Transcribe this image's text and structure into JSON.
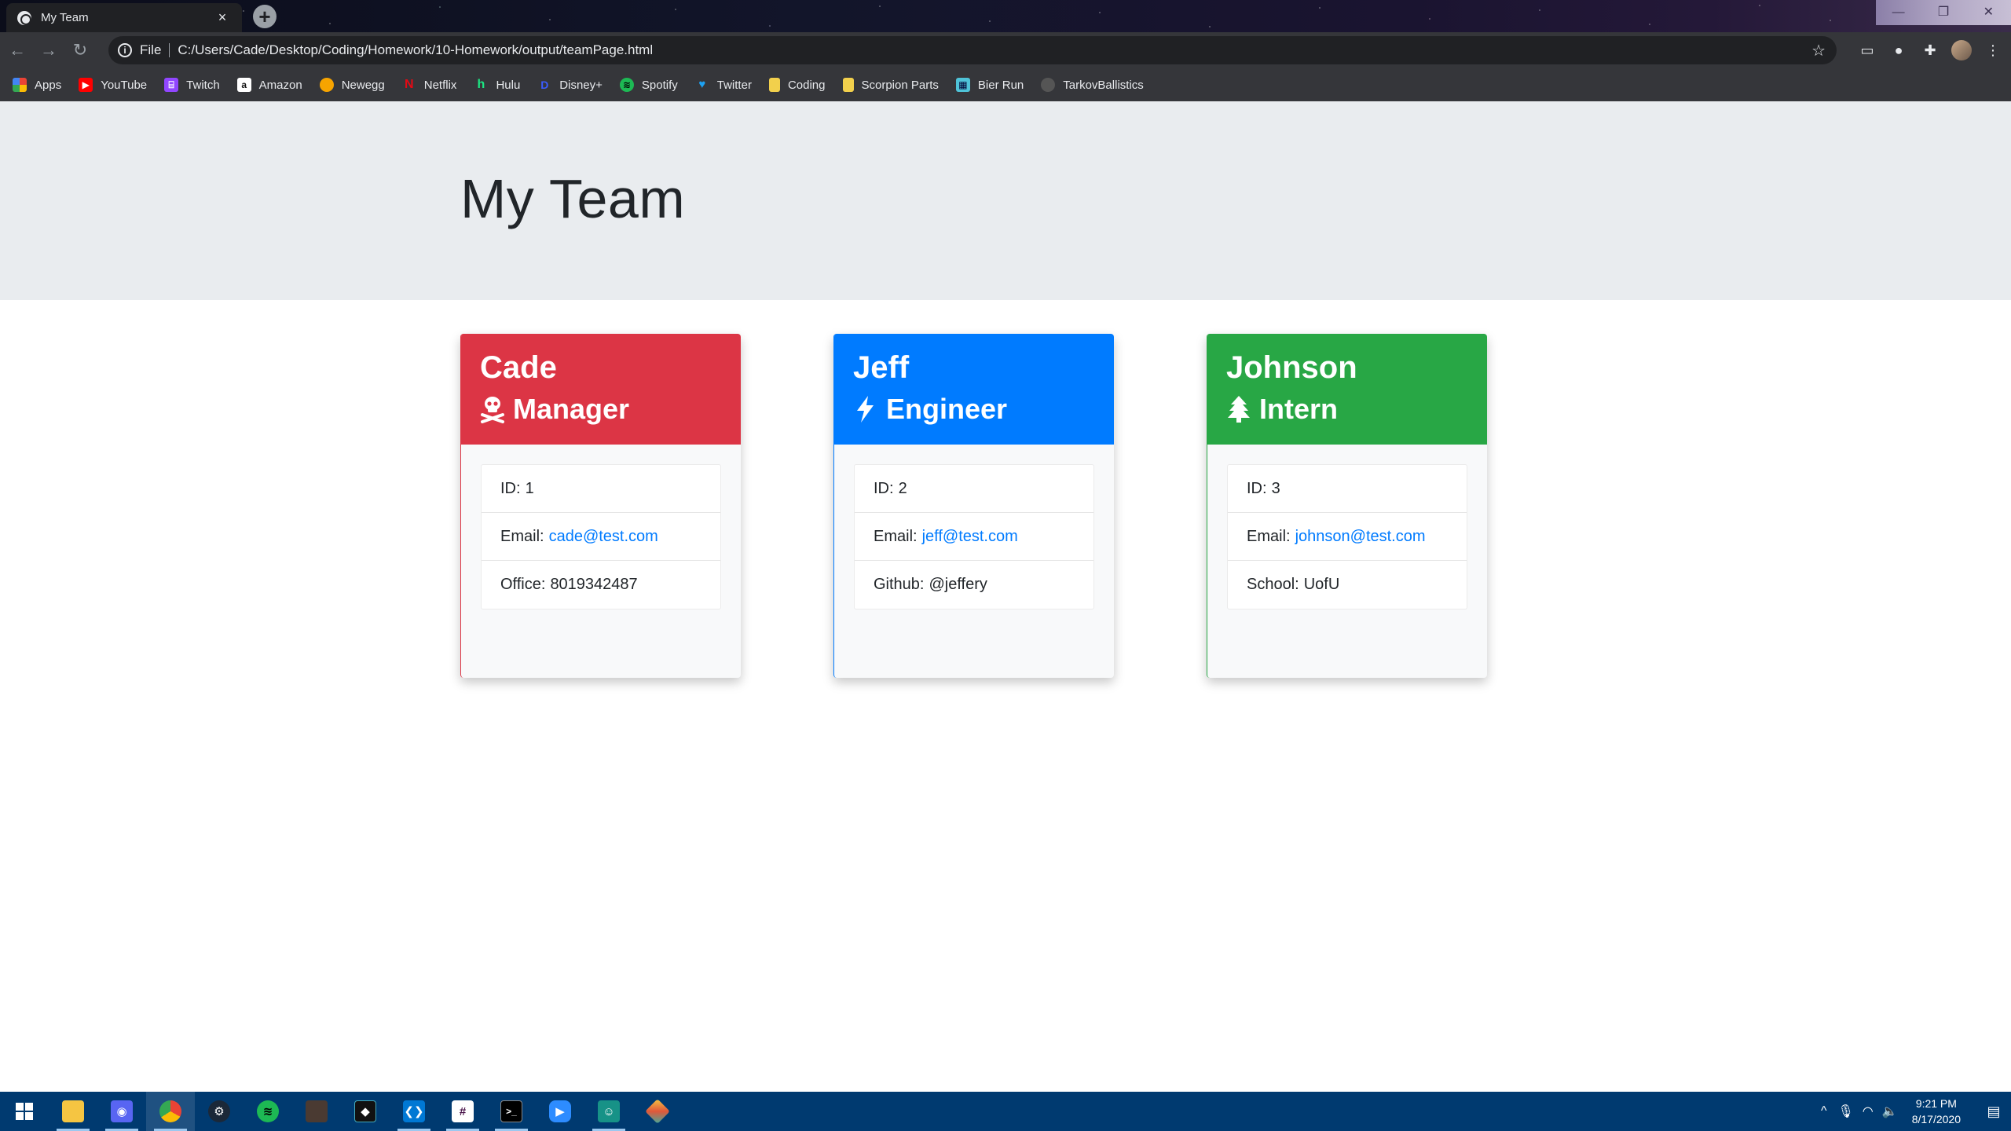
{
  "browser": {
    "tab_title": "My Team",
    "tab_close": "×",
    "new_tab": "+",
    "scheme": "File",
    "url": "C:/Users/Cade/Desktop/Coding/Homework/10-Homework/output/teamPage.html",
    "bookmarks": [
      {
        "label": "Apps",
        "icon": "apps-grid-icon",
        "color": "#ea4335"
      },
      {
        "label": "YouTube",
        "icon": "youtube-icon",
        "color": "#ff0000"
      },
      {
        "label": "Twitch",
        "icon": "twitch-icon",
        "color": "#9146ff"
      },
      {
        "label": "Amazon",
        "icon": "amazon-icon",
        "color": "#ffffff"
      },
      {
        "label": "Newegg",
        "icon": "newegg-icon",
        "color": "#f7a400"
      },
      {
        "label": "Netflix",
        "icon": "netflix-icon",
        "color": "#e50914"
      },
      {
        "label": "Hulu",
        "icon": "hulu-icon",
        "color": "#1ce783"
      },
      {
        "label": "Disney+",
        "icon": "disney-icon",
        "color": "#113ccf"
      },
      {
        "label": "Spotify",
        "icon": "spotify-icon",
        "color": "#1db954"
      },
      {
        "label": "Twitter",
        "icon": "twitter-icon",
        "color": "#1da1f2"
      },
      {
        "label": "Coding",
        "icon": "folder-icon",
        "color": "#f2d04c"
      },
      {
        "label": "Scorpion Parts",
        "icon": "folder-icon",
        "color": "#f2d04c"
      },
      {
        "label": "Bier Run",
        "icon": "bier-run-icon",
        "color": "#4fc3d8"
      },
      {
        "label": "TarkovBallistics",
        "icon": "tarkov-icon",
        "color": "#555555"
      }
    ]
  },
  "page": {
    "title": "My Team"
  },
  "team": [
    {
      "name": "Cade",
      "role": "Manager",
      "role_icon": "skull-crossbones-icon",
      "color": "#dc3545",
      "id_label": "ID:",
      "id": "1",
      "email_label": "Email:",
      "email": "cade@test.com",
      "extra_label": "Office:",
      "extra": "8019342487"
    },
    {
      "name": "Jeff",
      "role": "Engineer",
      "role_icon": "bolt-icon",
      "color": "#007bff",
      "id_label": "ID:",
      "id": "2",
      "email_label": "Email:",
      "email": "jeff@test.com",
      "extra_label": "Github:",
      "extra": "@jeffery"
    },
    {
      "name": "Johnson",
      "role": "Intern",
      "role_icon": "tree-icon",
      "color": "#28a745",
      "id_label": "ID:",
      "id": "3",
      "email_label": "Email:",
      "email": "johnson@test.com",
      "extra_label": "School:",
      "extra": "UofU"
    }
  ],
  "taskbar": {
    "clock_time": "9:21 PM",
    "clock_date": "8/17/2020"
  }
}
